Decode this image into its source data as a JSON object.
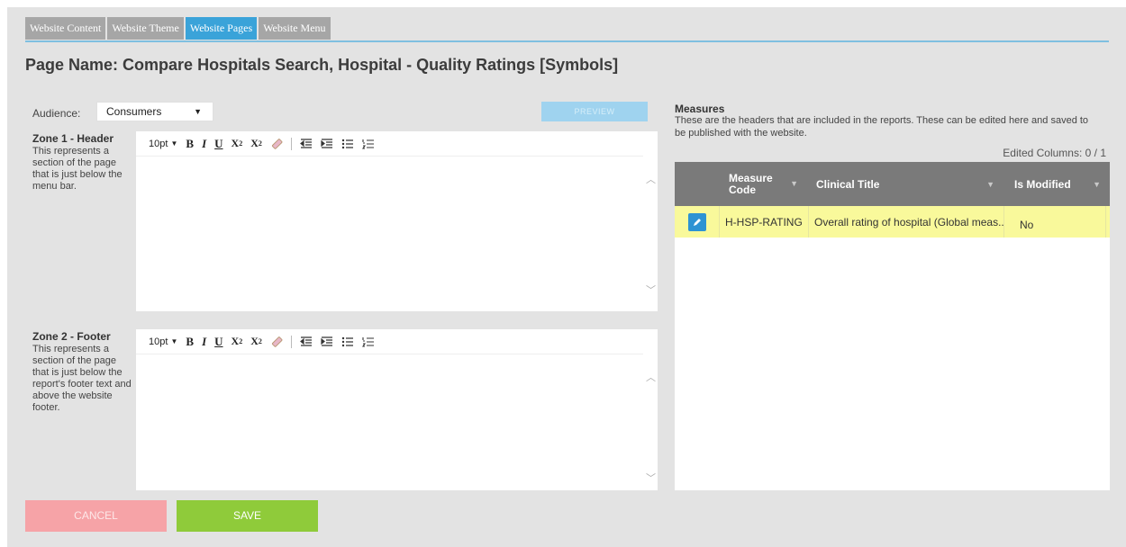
{
  "tabs": [
    {
      "label": "Website Content",
      "active": false
    },
    {
      "label": "Website Theme",
      "active": false
    },
    {
      "label": "Website Pages",
      "active": true
    },
    {
      "label": "Website Menu",
      "active": false
    }
  ],
  "page_title": "Page Name: Compare Hospitals Search, Hospital - Quality Ratings [Symbols]",
  "audience": {
    "label": "Audience:",
    "value": "Consumers"
  },
  "preview_label": "PREVIEW",
  "zone1": {
    "title": "Zone 1 - Header",
    "description": "This represents a section of the page that is just below the menu bar.",
    "font_size": "10pt"
  },
  "zone2": {
    "title": "Zone 2 - Footer",
    "description": "This represents a section of the page that is just below the report's footer text and above the website footer.",
    "font_size": "10pt"
  },
  "buttons": {
    "cancel": "CANCEL",
    "save": "SAVE"
  },
  "measures": {
    "title": "Measures",
    "description": "These are the headers that are included in the reports.  These can be edited here and saved to be published with the website.",
    "edited_columns": "Edited Columns: 0 / 1",
    "columns": [
      "Measure Code",
      "Clinical Title",
      "Is Modified"
    ],
    "rows": [
      {
        "code": "H-HSP-RATING",
        "title": "Overall rating of hospital (Global meas...",
        "modified": "No"
      }
    ]
  },
  "colors": {
    "active_tab": "#3aa3d9",
    "inactive_tab": "#a6a6a6",
    "save": "#8fcb3a",
    "cancel": "#f6a3a7",
    "row_highlight": "#f9f99b",
    "grid_header": "#7a7a7a"
  }
}
